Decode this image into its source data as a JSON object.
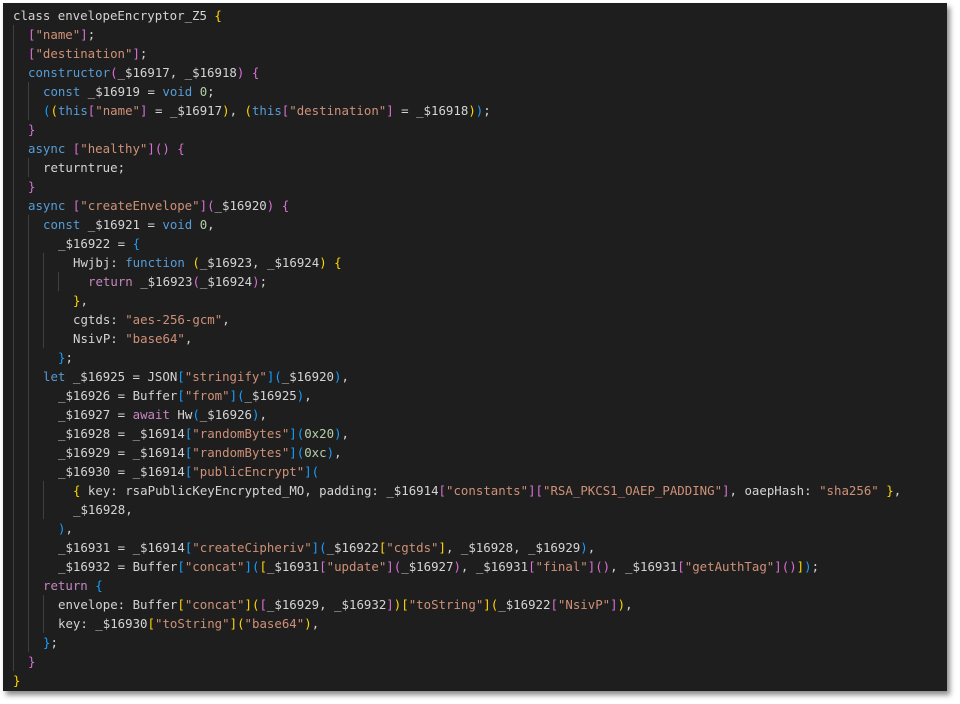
{
  "editor": {
    "theme_colors": {
      "background": "#1e1e1e",
      "keyword": "#569cd6",
      "control": "#c586c0",
      "string": "#ce9178",
      "number": "#b5cea8",
      "text": "#d4d4d4",
      "bracket1": "#ffd700",
      "bracket2": "#da70d6",
      "bracket3": "#179fff"
    },
    "lines": [
      {
        "indent": 0,
        "tokens": [
          [
            "t-var",
            "class envelopeEncryptor_Z5 "
          ],
          [
            "t-b1",
            "{"
          ]
        ]
      },
      {
        "indent": 1,
        "tokens": [
          [
            "t-b2",
            "["
          ],
          [
            "t-str",
            "\"name\""
          ],
          [
            "t-b2",
            "]"
          ],
          [
            "t-var",
            ";"
          ]
        ]
      },
      {
        "indent": 1,
        "tokens": [
          [
            "t-b2",
            "["
          ],
          [
            "t-str",
            "\"destination\""
          ],
          [
            "t-b2",
            "]"
          ],
          [
            "t-var",
            ";"
          ]
        ]
      },
      {
        "indent": 1,
        "tokens": [
          [
            "t-kw",
            "constructor"
          ],
          [
            "t-b2",
            "("
          ],
          [
            "t-var",
            "_$16917, _$16918"
          ],
          [
            "t-b2",
            ")"
          ],
          [
            "t-var",
            " "
          ],
          [
            "t-b2",
            "{"
          ]
        ]
      },
      {
        "indent": 2,
        "tokens": [
          [
            "t-kw",
            "const"
          ],
          [
            "t-var",
            " _$16919 = "
          ],
          [
            "t-kw",
            "void"
          ],
          [
            "t-var",
            " "
          ],
          [
            "t-num",
            "0"
          ],
          [
            "t-var",
            ";"
          ]
        ]
      },
      {
        "indent": 2,
        "tokens": [
          [
            "t-b3",
            "("
          ],
          [
            "t-b1",
            "("
          ],
          [
            "t-kw",
            "this"
          ],
          [
            "t-b2",
            "["
          ],
          [
            "t-str",
            "\"name\""
          ],
          [
            "t-b2",
            "]"
          ],
          [
            "t-var",
            " = _$16917"
          ],
          [
            "t-b1",
            ")"
          ],
          [
            "t-var",
            ", "
          ],
          [
            "t-b1",
            "("
          ],
          [
            "t-kw",
            "this"
          ],
          [
            "t-b2",
            "["
          ],
          [
            "t-str",
            "\"destination\""
          ],
          [
            "t-b2",
            "]"
          ],
          [
            "t-var",
            " = _$16918"
          ],
          [
            "t-b1",
            ")"
          ],
          [
            "t-b3",
            ")"
          ],
          [
            "t-var",
            ";"
          ]
        ]
      },
      {
        "indent": 1,
        "tokens": [
          [
            "t-b2",
            "}"
          ]
        ]
      },
      {
        "indent": 1,
        "tokens": [
          [
            "t-kw",
            "async"
          ],
          [
            "t-var",
            " "
          ],
          [
            "t-b2",
            "["
          ],
          [
            "t-str",
            "\"healthy\""
          ],
          [
            "t-b2",
            "]"
          ],
          [
            "t-b2",
            "()"
          ],
          [
            "t-var",
            " "
          ],
          [
            "t-b2",
            "{"
          ]
        ]
      },
      {
        "indent": 2,
        "tokens": [
          [
            "t-var",
            "returntrue;"
          ]
        ]
      },
      {
        "indent": 1,
        "tokens": [
          [
            "t-b2",
            "}"
          ]
        ]
      },
      {
        "indent": 1,
        "tokens": [
          [
            "t-kw",
            "async"
          ],
          [
            "t-var",
            " "
          ],
          [
            "t-b2",
            "["
          ],
          [
            "t-str",
            "\"createEnvelope\""
          ],
          [
            "t-b2",
            "]"
          ],
          [
            "t-b2",
            "("
          ],
          [
            "t-var",
            "_$16920"
          ],
          [
            "t-b2",
            ")"
          ],
          [
            "t-var",
            " "
          ],
          [
            "t-b2",
            "{"
          ]
        ]
      },
      {
        "indent": 2,
        "tokens": [
          [
            "t-kw",
            "const"
          ],
          [
            "t-var",
            " _$16921 = "
          ],
          [
            "t-kw",
            "void"
          ],
          [
            "t-var",
            " "
          ],
          [
            "t-num",
            "0"
          ],
          [
            "t-var",
            ","
          ]
        ]
      },
      {
        "indent": 2,
        "half": true,
        "tokens": [
          [
            "t-var",
            "_$16922 = "
          ],
          [
            "t-b3",
            "{"
          ]
        ]
      },
      {
        "indent": 3,
        "half": true,
        "tokens": [
          [
            "t-var",
            "Hwjbj: "
          ],
          [
            "t-kw",
            "function"
          ],
          [
            "t-var",
            " "
          ],
          [
            "t-b1",
            "("
          ],
          [
            "t-var",
            "_$16923, _$16924"
          ],
          [
            "t-b1",
            ")"
          ],
          [
            "t-var",
            " "
          ],
          [
            "t-b1",
            "{"
          ]
        ]
      },
      {
        "indent": 4,
        "half": true,
        "tokens": [
          [
            "t-ctrl",
            "return"
          ],
          [
            "t-var",
            " _$16923"
          ],
          [
            "t-b2",
            "("
          ],
          [
            "t-var",
            "_$16924"
          ],
          [
            "t-b2",
            ")"
          ],
          [
            "t-var",
            ";"
          ]
        ]
      },
      {
        "indent": 3,
        "half": true,
        "tokens": [
          [
            "t-b1",
            "}"
          ],
          [
            "t-var",
            ","
          ]
        ]
      },
      {
        "indent": 3,
        "half": true,
        "tokens": [
          [
            "t-var",
            "cgtds: "
          ],
          [
            "t-str",
            "\"aes-256-gcm\""
          ],
          [
            "t-var",
            ","
          ]
        ]
      },
      {
        "indent": 3,
        "half": true,
        "tokens": [
          [
            "t-var",
            "NsivP: "
          ],
          [
            "t-str",
            "\"base64\""
          ],
          [
            "t-var",
            ","
          ]
        ]
      },
      {
        "indent": 2,
        "half": true,
        "tokens": [
          [
            "t-b3",
            "}"
          ],
          [
            "t-var",
            ";"
          ]
        ]
      },
      {
        "indent": 2,
        "tokens": [
          [
            "t-kw",
            "let"
          ],
          [
            "t-var",
            " _$16925 = JSON"
          ],
          [
            "t-b3",
            "["
          ],
          [
            "t-str",
            "\"stringify\""
          ],
          [
            "t-b3",
            "]"
          ],
          [
            "t-b3",
            "("
          ],
          [
            "t-var",
            "_$16920"
          ],
          [
            "t-b3",
            ")"
          ],
          [
            "t-var",
            ","
          ]
        ]
      },
      {
        "indent": 2,
        "half": true,
        "tokens": [
          [
            "t-var",
            "_$16926 = Buffer"
          ],
          [
            "t-b3",
            "["
          ],
          [
            "t-str",
            "\"from\""
          ],
          [
            "t-b3",
            "]"
          ],
          [
            "t-b3",
            "("
          ],
          [
            "t-var",
            "_$16925"
          ],
          [
            "t-b3",
            ")"
          ],
          [
            "t-var",
            ","
          ]
        ]
      },
      {
        "indent": 2,
        "half": true,
        "tokens": [
          [
            "t-var",
            "_$16927 = "
          ],
          [
            "t-ctrl",
            "await"
          ],
          [
            "t-var",
            " Hw"
          ],
          [
            "t-b3",
            "("
          ],
          [
            "t-var",
            "_$16926"
          ],
          [
            "t-b3",
            ")"
          ],
          [
            "t-var",
            ","
          ]
        ]
      },
      {
        "indent": 2,
        "half": true,
        "tokens": [
          [
            "t-var",
            "_$16928 = _$16914"
          ],
          [
            "t-b3",
            "["
          ],
          [
            "t-str",
            "\"randomBytes\""
          ],
          [
            "t-b3",
            "]"
          ],
          [
            "t-b3",
            "("
          ],
          [
            "t-num",
            "0x20"
          ],
          [
            "t-b3",
            ")"
          ],
          [
            "t-var",
            ","
          ]
        ]
      },
      {
        "indent": 2,
        "half": true,
        "tokens": [
          [
            "t-var",
            "_$16929 = _$16914"
          ],
          [
            "t-b3",
            "["
          ],
          [
            "t-str",
            "\"randomBytes\""
          ],
          [
            "t-b3",
            "]"
          ],
          [
            "t-b3",
            "("
          ],
          [
            "t-num",
            "0xc"
          ],
          [
            "t-b3",
            ")"
          ],
          [
            "t-var",
            ","
          ]
        ]
      },
      {
        "indent": 2,
        "half": true,
        "tokens": [
          [
            "t-var",
            "_$16930 = _$16914"
          ],
          [
            "t-b3",
            "["
          ],
          [
            "t-str",
            "\"publicEncrypt\""
          ],
          [
            "t-b3",
            "]"
          ],
          [
            "t-b3",
            "("
          ]
        ]
      },
      {
        "indent": 3,
        "half": true,
        "tokens": [
          [
            "t-b1",
            "{"
          ],
          [
            "t-var",
            " key: rsaPublicKeyEncrypted_MO, padding: _$16914"
          ],
          [
            "t-b2",
            "["
          ],
          [
            "t-str",
            "\"constants\""
          ],
          [
            "t-b2",
            "]"
          ],
          [
            "t-b2",
            "["
          ],
          [
            "t-str",
            "\"RSA_PKCS1_OAEP_PADDING\""
          ],
          [
            "t-b2",
            "]"
          ],
          [
            "t-var",
            ", oaepHash: "
          ],
          [
            "t-str",
            "\"sha256\""
          ],
          [
            "t-var",
            " "
          ],
          [
            "t-b1",
            "}"
          ],
          [
            "t-var",
            ","
          ]
        ]
      },
      {
        "indent": 3,
        "half": true,
        "tokens": [
          [
            "t-var",
            "_$16928,"
          ]
        ]
      },
      {
        "indent": 2,
        "half": true,
        "tokens": [
          [
            "t-b3",
            ")"
          ],
          [
            "t-var",
            ","
          ]
        ]
      },
      {
        "indent": 2,
        "half": true,
        "tokens": [
          [
            "t-var",
            "_$16931 = _$16914"
          ],
          [
            "t-b3",
            "["
          ],
          [
            "t-str",
            "\"createCipheriv\""
          ],
          [
            "t-b3",
            "]"
          ],
          [
            "t-b3",
            "("
          ],
          [
            "t-var",
            "_$16922"
          ],
          [
            "t-b1",
            "["
          ],
          [
            "t-str",
            "\"cgtds\""
          ],
          [
            "t-b1",
            "]"
          ],
          [
            "t-var",
            ", _$16928, _$16929"
          ],
          [
            "t-b3",
            ")"
          ],
          [
            "t-var",
            ","
          ]
        ]
      },
      {
        "indent": 2,
        "half": true,
        "tokens": [
          [
            "t-var",
            "_$16932 = Buffer"
          ],
          [
            "t-b3",
            "["
          ],
          [
            "t-str",
            "\"concat\""
          ],
          [
            "t-b3",
            "]"
          ],
          [
            "t-b3",
            "("
          ],
          [
            "t-b1",
            "["
          ],
          [
            "t-var",
            "_$16931"
          ],
          [
            "t-b2",
            "["
          ],
          [
            "t-str",
            "\"update\""
          ],
          [
            "t-b2",
            "]"
          ],
          [
            "t-b2",
            "("
          ],
          [
            "t-var",
            "_$16927"
          ],
          [
            "t-b2",
            ")"
          ],
          [
            "t-var",
            ", _$16931"
          ],
          [
            "t-b2",
            "["
          ],
          [
            "t-str",
            "\"final\""
          ],
          [
            "t-b2",
            "]"
          ],
          [
            "t-b2",
            "()"
          ],
          [
            "t-var",
            ", _$16931"
          ],
          [
            "t-b2",
            "["
          ],
          [
            "t-str",
            "\"getAuthTag\""
          ],
          [
            "t-b2",
            "]"
          ],
          [
            "t-b2",
            "()"
          ],
          [
            "t-b1",
            "]"
          ],
          [
            "t-b3",
            ")"
          ],
          [
            "t-var",
            ";"
          ]
        ]
      },
      {
        "indent": 2,
        "tokens": [
          [
            "t-ctrl",
            "return"
          ],
          [
            "t-var",
            " "
          ],
          [
            "t-b3",
            "{"
          ]
        ]
      },
      {
        "indent": 3,
        "tokens": [
          [
            "t-var",
            "envelope: Buffer"
          ],
          [
            "t-b1",
            "["
          ],
          [
            "t-str",
            "\"concat\""
          ],
          [
            "t-b1",
            "]"
          ],
          [
            "t-b1",
            "("
          ],
          [
            "t-b2",
            "["
          ],
          [
            "t-var",
            "_$16929, _$16932"
          ],
          [
            "t-b2",
            "]"
          ],
          [
            "t-b1",
            ")"
          ],
          [
            "t-b1",
            "["
          ],
          [
            "t-str",
            "\"toString\""
          ],
          [
            "t-b1",
            "]"
          ],
          [
            "t-b1",
            "("
          ],
          [
            "t-var",
            "_$16922"
          ],
          [
            "t-b2",
            "["
          ],
          [
            "t-str",
            "\"NsivP\""
          ],
          [
            "t-b2",
            "]"
          ],
          [
            "t-b1",
            ")"
          ],
          [
            "t-var",
            ","
          ]
        ]
      },
      {
        "indent": 3,
        "tokens": [
          [
            "t-var",
            "key: _$16930"
          ],
          [
            "t-b1",
            "["
          ],
          [
            "t-str",
            "\"toString\""
          ],
          [
            "t-b1",
            "]"
          ],
          [
            "t-b1",
            "("
          ],
          [
            "t-str",
            "\"base64\""
          ],
          [
            "t-b1",
            ")"
          ],
          [
            "t-var",
            ","
          ]
        ]
      },
      {
        "indent": 2,
        "tokens": [
          [
            "t-b3",
            "}"
          ],
          [
            "t-var",
            ";"
          ]
        ]
      },
      {
        "indent": 1,
        "tokens": [
          [
            "t-b2",
            "}"
          ]
        ]
      },
      {
        "indent": 0,
        "tokens": [
          [
            "t-b1",
            "}"
          ]
        ]
      }
    ]
  }
}
